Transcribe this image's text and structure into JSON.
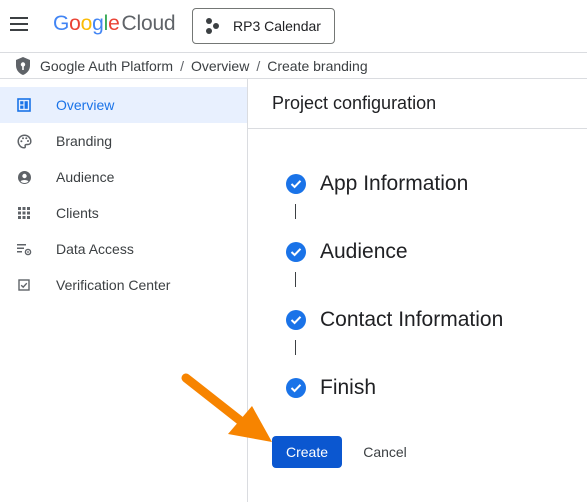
{
  "topbar": {
    "logo_google": "Google",
    "logo_cloud": "Cloud",
    "project": "RP3 Calendar"
  },
  "breadcrumb": [
    "Google Auth Platform",
    "Overview",
    "Create branding"
  ],
  "sidebar": {
    "items": [
      {
        "label": "Overview",
        "icon": "dashboard-icon",
        "active": true
      },
      {
        "label": "Branding",
        "icon": "palette-icon"
      },
      {
        "label": "Audience",
        "icon": "person-icon"
      },
      {
        "label": "Clients",
        "icon": "grid-icon"
      },
      {
        "label": "Data Access",
        "icon": "settings-list-icon"
      },
      {
        "label": "Verification Center",
        "icon": "check-box-icon"
      }
    ]
  },
  "main": {
    "title": "Project configuration",
    "steps": [
      "App Information",
      "Audience",
      "Contact Information",
      "Finish"
    ],
    "create_label": "Create",
    "cancel_label": "Cancel"
  },
  "colors": {
    "primary": "#0b57d0",
    "accent": "#1a73e8",
    "active_bg": "#e8f0fe",
    "annotation_arrow": "#f78400"
  }
}
